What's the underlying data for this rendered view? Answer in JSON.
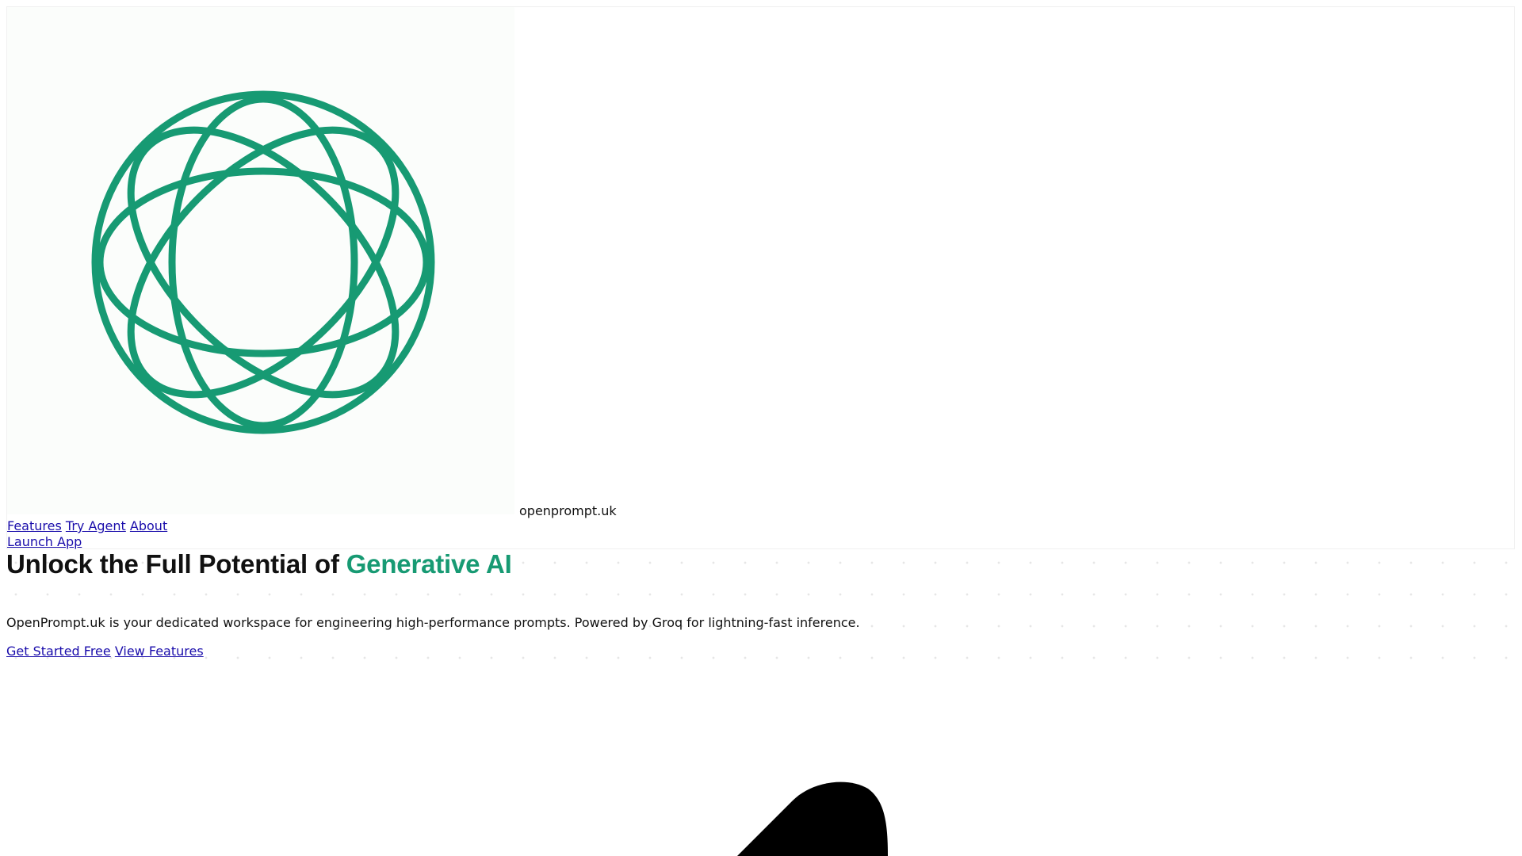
{
  "brand": {
    "name": "openprompt.uk",
    "logo_icon": "rosette-logo-icon",
    "accent_color": "#179a73"
  },
  "nav": {
    "items": [
      "Features",
      "Try Agent",
      "About"
    ],
    "launch_label": "Launch App"
  },
  "hero": {
    "title_prefix": "Unlock the Full Potential of ",
    "title_accent": "Generative AI",
    "description": "OpenPrompt.uk is your dedicated workspace for engineering high-performance prompts. Powered by Groq for lightning-fast inference.",
    "cta_primary": "Get Started Free",
    "cta_secondary": "View Features"
  },
  "decor": {
    "blob_icon": "black-blob-shape"
  }
}
